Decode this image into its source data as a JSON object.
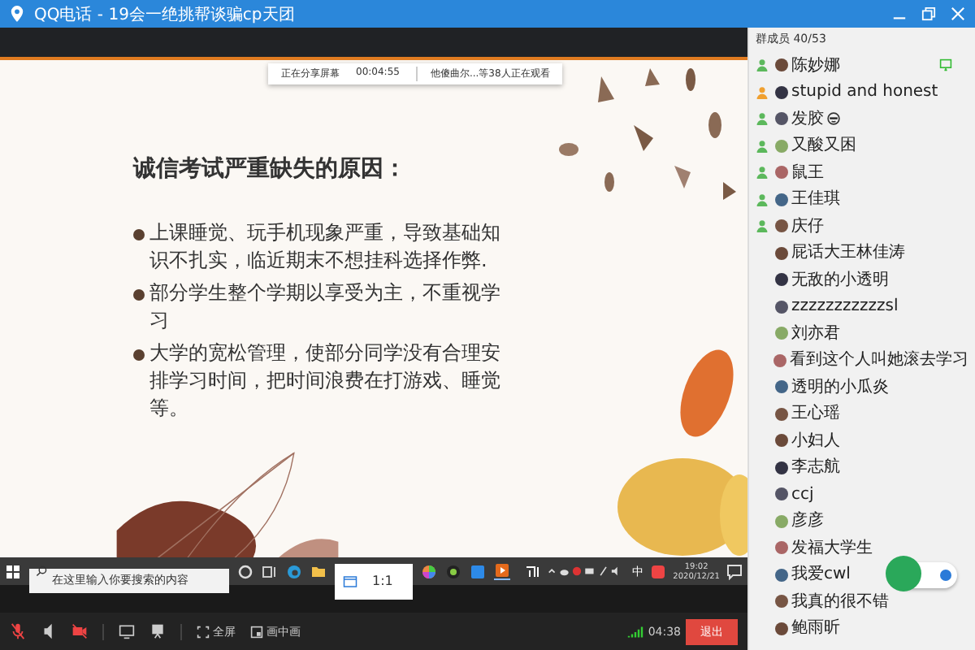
{
  "window": {
    "title": "QQ电话 - 19会一绝挑帮谈骗cp天团"
  },
  "share_banner": {
    "status": "正在分享屏幕",
    "duration": "00:04:55",
    "viewers": "他傻曲尔...等38人正在观看"
  },
  "slide": {
    "title": "诚信考试严重缺失的原因：",
    "bullets": [
      "上课睡觉、玩手机现象严重，导致基础知识不扎实，临近期末不想挂科选择作弊.",
      "部分学生整个学期以享受为主，不重视学习",
      "大学的宽松管理，使部分同学没有合理安排学习时间，把时间浪费在打游戏、睡觉等。"
    ]
  },
  "taskbar": {
    "search_placeholder": "在这里输入你要搜索的内容",
    "popup": "1:1",
    "ime": "中",
    "time": "19:02",
    "date": "2020/12/21"
  },
  "controls": {
    "mic_muted": true,
    "camera_off": true,
    "fullscreen": "全屏",
    "pip": "画中画",
    "elapsed": "04:38",
    "exit": "退出"
  },
  "members_header": "群成员 40/53",
  "members": [
    {
      "name": "陈妙娜",
      "in_call": true,
      "color": "#5cb85c",
      "sharing": true,
      "emoji": false
    },
    {
      "name": "stupid and honest",
      "in_call": true,
      "color": "#f0a030",
      "sharing": false,
      "emoji": false
    },
    {
      "name": "发胶",
      "in_call": true,
      "color": "#5cb85c",
      "sharing": false,
      "emoji": true
    },
    {
      "name": "又酸又困",
      "in_call": true,
      "color": "#5cb85c",
      "sharing": false,
      "emoji": false
    },
    {
      "name": "鼠王",
      "in_call": true,
      "color": "#5cb85c",
      "sharing": false,
      "emoji": false
    },
    {
      "name": "王佳琪",
      "in_call": true,
      "color": "#5cb85c",
      "sharing": false,
      "emoji": false
    },
    {
      "name": "庆仔",
      "in_call": true,
      "color": "#5cb85c",
      "sharing": false,
      "emoji": false
    },
    {
      "name": "屁话大王林佳涛",
      "in_call": false,
      "sharing": false,
      "emoji": false
    },
    {
      "name": "无敌的小透明",
      "in_call": false,
      "sharing": false,
      "emoji": false
    },
    {
      "name": "zzzzzzzzzzzsl",
      "in_call": false,
      "sharing": false,
      "emoji": false
    },
    {
      "name": "刘亦君",
      "in_call": false,
      "sharing": false,
      "emoji": false
    },
    {
      "name": "看到这个人叫她滚去学习",
      "in_call": false,
      "sharing": false,
      "emoji": false
    },
    {
      "name": "透明的小瓜炎",
      "in_call": false,
      "sharing": false,
      "emoji": false
    },
    {
      "name": "王心瑶",
      "in_call": false,
      "sharing": false,
      "emoji": false
    },
    {
      "name": "小妇人",
      "in_call": false,
      "sharing": false,
      "emoji": false
    },
    {
      "name": "李志航",
      "in_call": false,
      "sharing": false,
      "emoji": false
    },
    {
      "name": "ccj",
      "in_call": false,
      "sharing": false,
      "emoji": false
    },
    {
      "name": "彦彦",
      "in_call": false,
      "sharing": false,
      "emoji": false
    },
    {
      "name": "发福大学生",
      "in_call": false,
      "sharing": false,
      "emoji": false
    },
    {
      "name": "我爱cwl",
      "in_call": false,
      "sharing": false,
      "emoji": false
    },
    {
      "name": "我真的很不错",
      "in_call": false,
      "sharing": false,
      "emoji": false
    },
    {
      "name": "鲍雨昕",
      "in_call": false,
      "sharing": false,
      "emoji": false
    }
  ]
}
